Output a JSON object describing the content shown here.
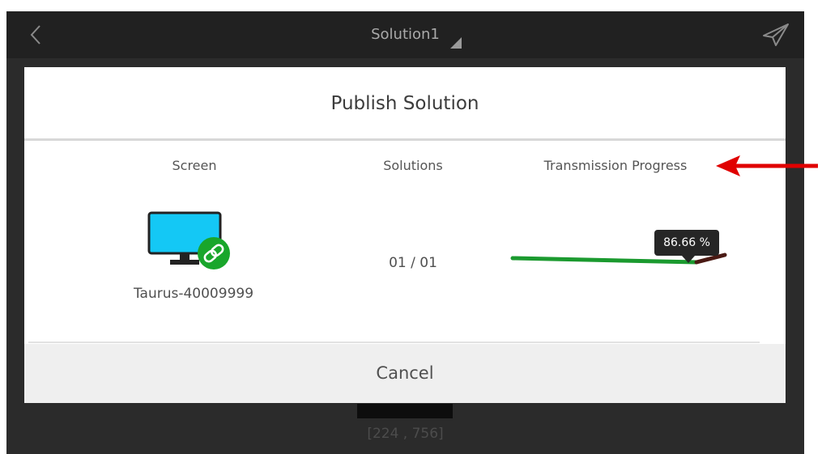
{
  "topbar": {
    "title": "Solution1"
  },
  "dialog": {
    "title": "Publish Solution",
    "columns": {
      "screen": "Screen",
      "solutions": "Solutions",
      "progress": "Transmission Progress"
    },
    "row": {
      "screen_name": "Taurus-40009999",
      "solutions": "01 / 01",
      "progress_label": "86.66 %",
      "progress_fraction": 0.8666
    },
    "cancel_label": "Cancel"
  },
  "background": {
    "coords": "[224 , 756]"
  },
  "colors": {
    "progress_done": "#1b9a2f",
    "progress_rest": "#4a1a14",
    "monitor_screen": "#14c8f5",
    "link_badge": "#19a62b",
    "annotation_arrow": "#e00000"
  }
}
